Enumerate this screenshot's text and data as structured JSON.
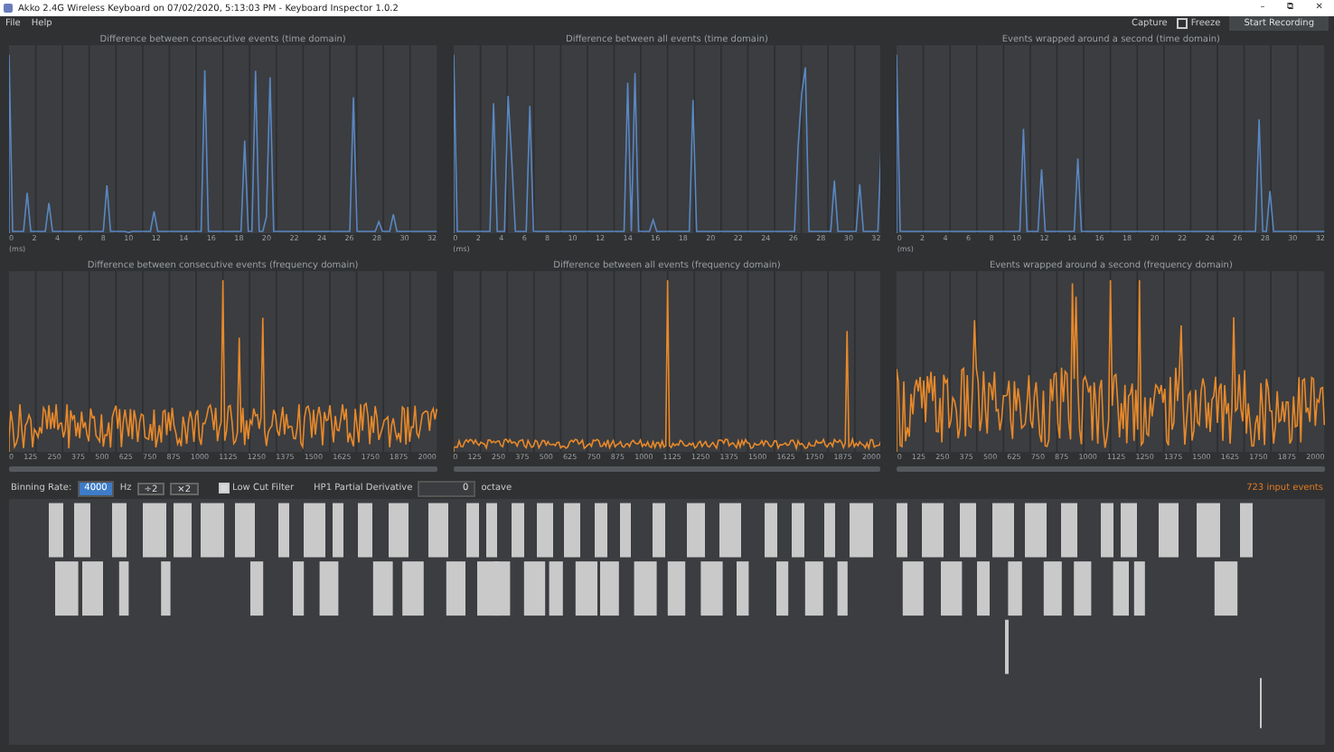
{
  "window": {
    "title": "Akko 2.4G Wireless Keyboard on 07/02/2020, 5:13:03 PM - Keyboard Inspector 1.0.2",
    "controls": [
      "–",
      "⧉",
      "✕"
    ]
  },
  "menu": [
    "File",
    "Help"
  ],
  "toolbar": {
    "capture": "Capture",
    "freeze": {
      "label": "Freeze",
      "checked": false
    },
    "record_button": "Start Recording"
  },
  "rows": [
    {
      "kind": "time",
      "panels": [
        {
          "title": "Difference between consecutive events (time domain)",
          "ticks": [
            "0",
            "2",
            "4",
            "6",
            "8",
            "10",
            "12",
            "14",
            "16",
            "18",
            "20",
            "22",
            "24",
            "26",
            "28",
            "30",
            "32"
          ],
          "unit": "(ms)"
        },
        {
          "title": "Difference between all events (time domain)",
          "ticks": [
            "0",
            "2",
            "4",
            "6",
            "8",
            "10",
            "12",
            "14",
            "16",
            "18",
            "20",
            "22",
            "24",
            "26",
            "28",
            "30",
            "32"
          ],
          "unit": "(ms)"
        },
        {
          "title": "Events wrapped around a second (time domain)",
          "ticks": [
            "0",
            "2",
            "4",
            "6",
            "8",
            "10",
            "12",
            "14",
            "16",
            "18",
            "20",
            "22",
            "24",
            "26",
            "28",
            "30",
            "32"
          ],
          "unit": "(ms)"
        }
      ]
    },
    {
      "kind": "frequency",
      "panels": [
        {
          "title": "Difference between consecutive events (frequency domain)",
          "ticks": [
            "0",
            "125",
            "250",
            "375",
            "500",
            "625",
            "750",
            "875",
            "1000",
            "1125",
            "1250",
            "1375",
            "1500",
            "1625",
            "1750",
            "1875",
            "2000"
          ]
        },
        {
          "title": "Difference between all events (frequency domain)",
          "ticks": [
            "0",
            "125",
            "250",
            "375",
            "500",
            "625",
            "750",
            "875",
            "1000",
            "1125",
            "1250",
            "1375",
            "1500",
            "1625",
            "1750",
            "1875",
            "2000"
          ]
        },
        {
          "title": "Events wrapped around a second (frequency domain)",
          "ticks": [
            "0",
            "125",
            "250",
            "375",
            "500",
            "625",
            "750",
            "875",
            "1000",
            "1125",
            "1250",
            "1375",
            "1500",
            "1625",
            "1750",
            "1875",
            "2000"
          ]
        }
      ]
    }
  ],
  "controls": {
    "binning_label": "Binning Rate:",
    "binning_value": "4000",
    "binning_unit": "Hz",
    "halve": "÷2",
    "double": "×2",
    "low_cut": {
      "label": "Low Cut Filter",
      "checked": true
    },
    "hp_label": "HP1 Partial Derivative",
    "hp_value": "0",
    "hp_unit": "octave",
    "events": "723 input events"
  }
}
